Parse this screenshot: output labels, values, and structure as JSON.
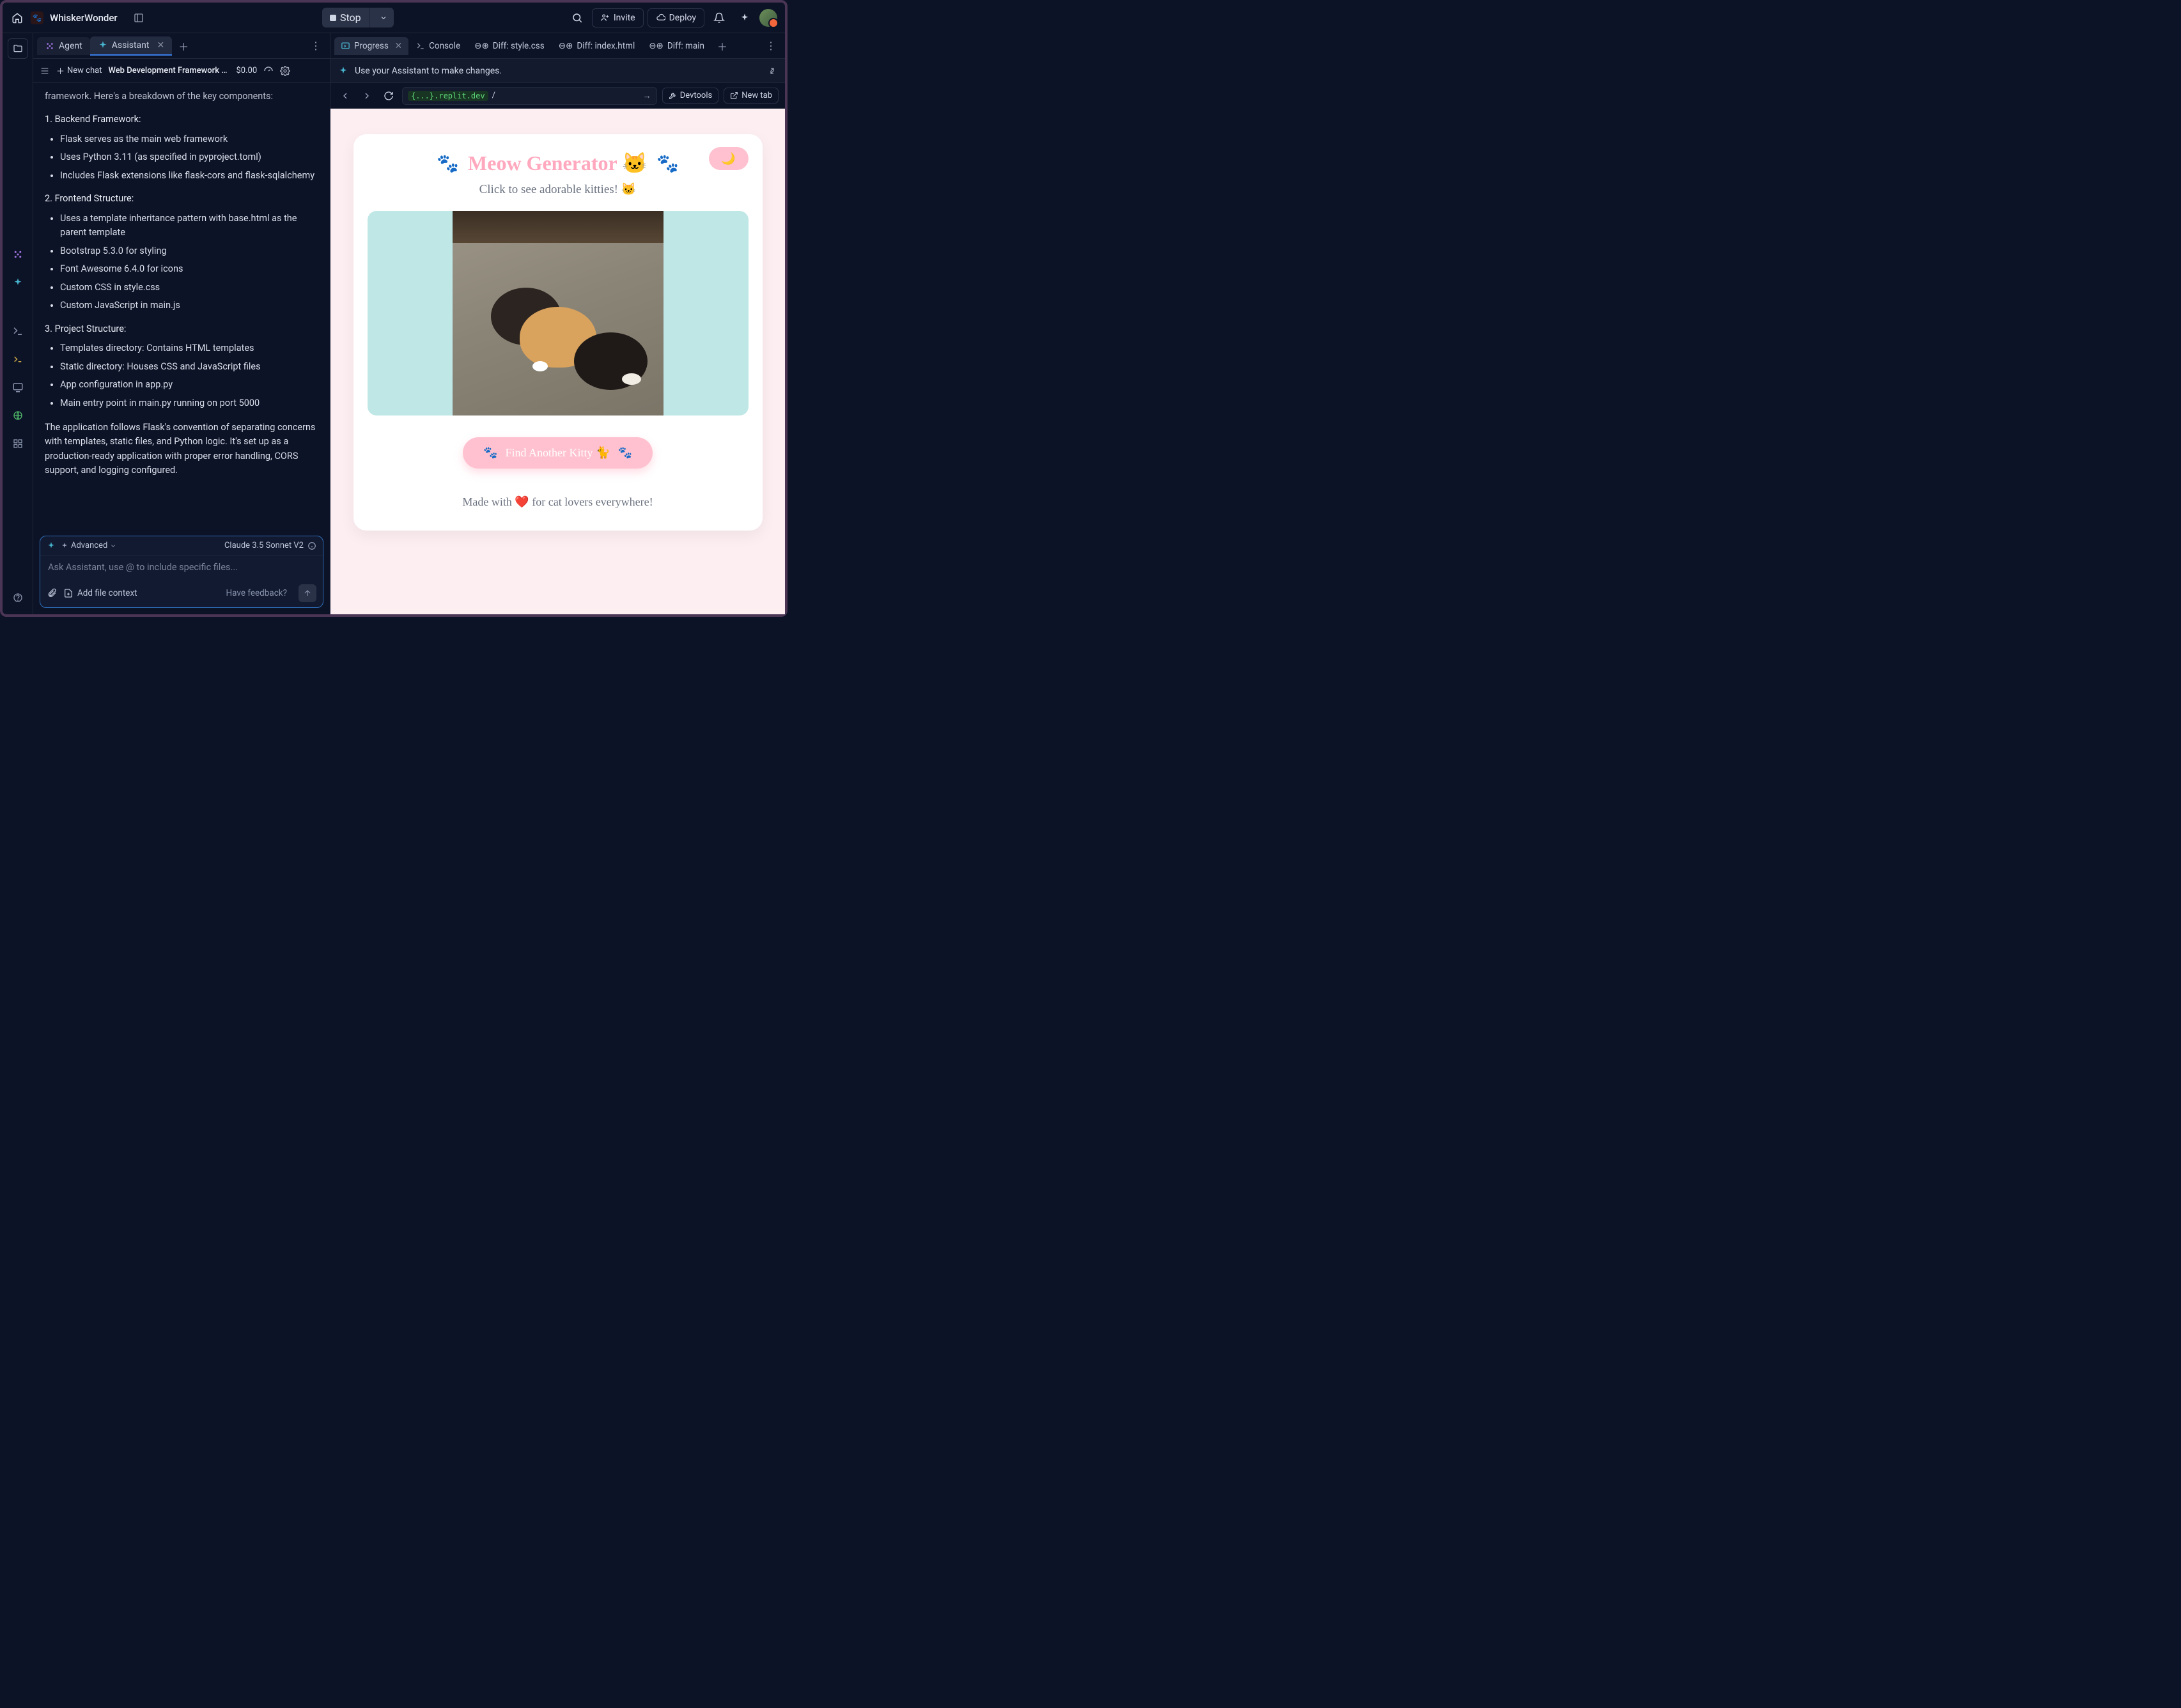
{
  "topbar": {
    "app_name": "WhiskerWonder",
    "stop_label": "Stop",
    "invite_label": "Invite",
    "deploy_label": "Deploy"
  },
  "left_tabs": {
    "agent": "Agent",
    "assistant": "Assistant"
  },
  "subbar": {
    "new_chat": "New chat",
    "title": "Web Development Framework Disc...",
    "price": "$0.00"
  },
  "chat": {
    "intro": "framework. Here's a breakdown of the key components:",
    "s1_head": "1. Backend Framework:",
    "s1_items": [
      "Flask serves as the main web framework",
      "Uses Python 3.11 (as specified in pyproject.toml)",
      "Includes Flask extensions like flask-cors and flask-sqlalchemy"
    ],
    "s2_head": "2. Frontend Structure:",
    "s2_items": [
      "Uses a template inheritance pattern with base.html as the parent template",
      "Bootstrap 5.3.0 for styling",
      "Font Awesome 6.4.0 for icons",
      "Custom CSS in style.css",
      "Custom JavaScript in main.js"
    ],
    "s3_head": "3. Project Structure:",
    "s3_items": [
      "Templates directory: Contains HTML templates",
      "Static directory: Houses CSS and JavaScript files",
      "App configuration in app.py",
      "Main entry point in main.py running on port 5000"
    ],
    "closing": "The application follows Flask's convention of separating concerns with templates, static files, and Python logic. It's set up as a production-ready application with proper error handling, CORS support, and logging configured."
  },
  "input": {
    "advanced": "Advanced",
    "model": "Claude 3.5 Sonnet V2",
    "placeholder": "Ask Assistant, use @ to include specific files...",
    "add_context": "Add file context",
    "feedback": "Have feedback?"
  },
  "right_tabs": {
    "progress": "Progress",
    "console": "Console",
    "diff_style": "Diff: style.css",
    "diff_index": "Diff: index.html",
    "diff_main": "Diff: main"
  },
  "banner": "Use your Assistant to make changes.",
  "url": {
    "host": "{...}.replit.dev",
    "path": "/",
    "devtools": "Devtools",
    "newtab": "New tab"
  },
  "webview": {
    "title": "Meow Generator 🐱",
    "subtitle": "Click to see adorable kitties! 🐱",
    "button": "Find Another Kitty 🐈",
    "footer": "Made with ❤️ for cat lovers everywhere!"
  }
}
